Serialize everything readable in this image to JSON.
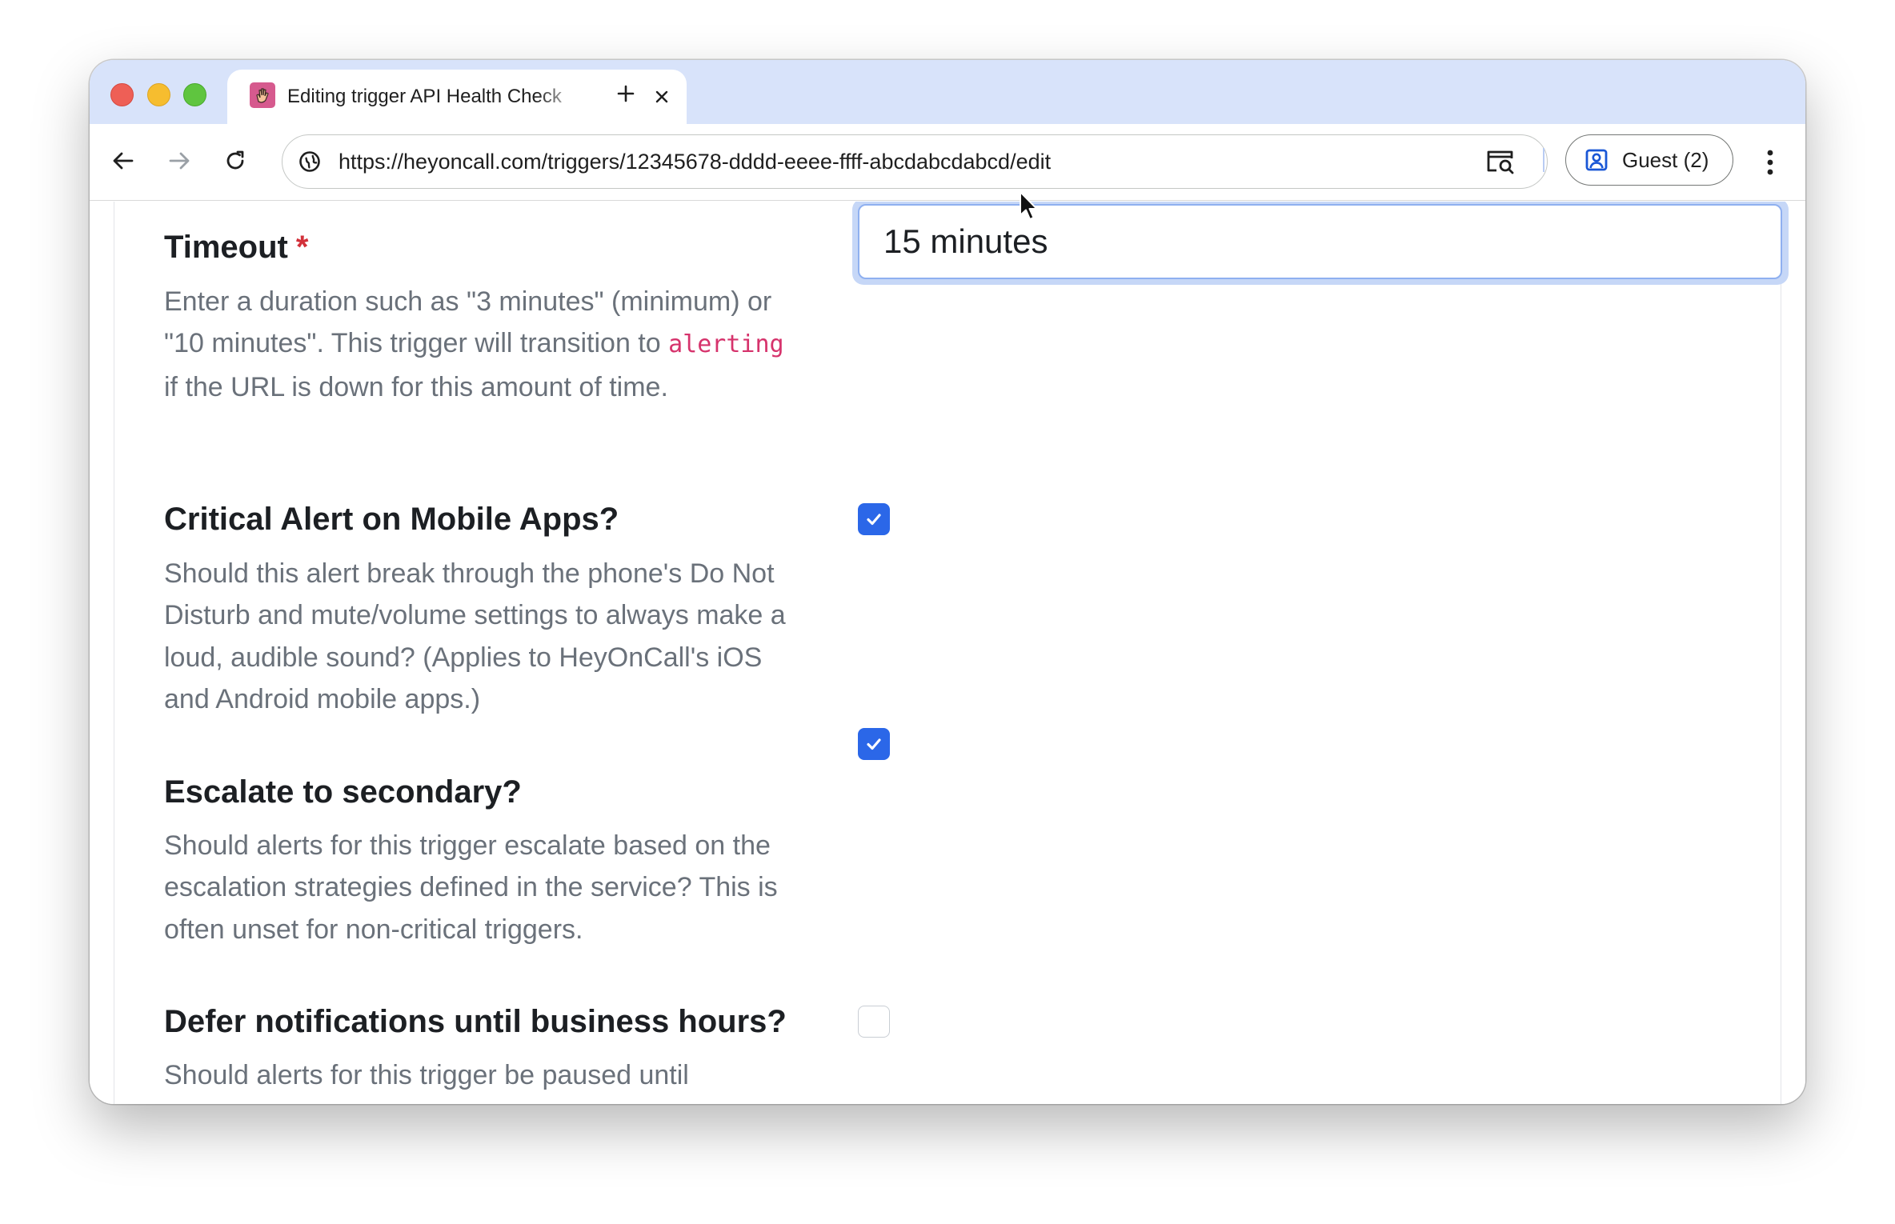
{
  "browser": {
    "tab": {
      "title": "Editing trigger API Health Check",
      "favicon": "wave-hand-icon"
    },
    "new_tab_icon": "plus-icon",
    "close_tab_icon": "close-icon",
    "url": "https://heyoncall.com/triggers/12345678-dddd-eeee-ffff-abcdabcdabcd/edit",
    "profile_label": "Guest (2)",
    "colors": {
      "tabstrip": "#d8e3fa",
      "accent": "#2b67e8"
    }
  },
  "form": {
    "timeout": {
      "label": "Timeout",
      "required_mark": "*",
      "help_prefix": "Enter a duration such as \"3 minutes\" (minimum) or \"10 minutes\". This trigger will transition to ",
      "help_code": "alerting",
      "help_suffix": " if the URL is down for this amount of time.",
      "value": "15 minutes"
    },
    "critical_alert": {
      "label": "Critical Alert on Mobile Apps?",
      "help": "Should this alert break through the phone's Do Not Disturb and mute/volume settings to always make a loud, audible sound? (Applies to HeyOnCall's iOS and Android mobile apps.)",
      "checked": true
    },
    "escalate": {
      "label": "Escalate to secondary?",
      "help": "Should alerts for this trigger escalate based on the escalation strategies defined in the service? This is often unset for non-critical triggers.",
      "checked": true
    },
    "defer": {
      "label": "Defer notifications until business hours?",
      "help": "Should alerts for this trigger be paused until",
      "checked": false
    }
  }
}
